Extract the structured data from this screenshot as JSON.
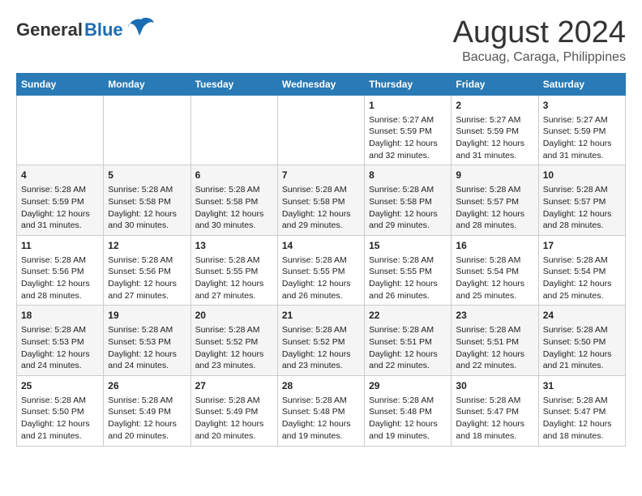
{
  "header": {
    "logo_general": "General",
    "logo_blue": "Blue",
    "month_title": "August 2024",
    "location": "Bacuag, Caraga, Philippines"
  },
  "days_of_week": [
    "Sunday",
    "Monday",
    "Tuesday",
    "Wednesday",
    "Thursday",
    "Friday",
    "Saturday"
  ],
  "weeks": [
    [
      {
        "day": "",
        "content": ""
      },
      {
        "day": "",
        "content": ""
      },
      {
        "day": "",
        "content": ""
      },
      {
        "day": "",
        "content": ""
      },
      {
        "day": "1",
        "content": "Sunrise: 5:27 AM\nSunset: 5:59 PM\nDaylight: 12 hours\nand 32 minutes."
      },
      {
        "day": "2",
        "content": "Sunrise: 5:27 AM\nSunset: 5:59 PM\nDaylight: 12 hours\nand 31 minutes."
      },
      {
        "day": "3",
        "content": "Sunrise: 5:27 AM\nSunset: 5:59 PM\nDaylight: 12 hours\nand 31 minutes."
      }
    ],
    [
      {
        "day": "4",
        "content": "Sunrise: 5:28 AM\nSunset: 5:59 PM\nDaylight: 12 hours\nand 31 minutes."
      },
      {
        "day": "5",
        "content": "Sunrise: 5:28 AM\nSunset: 5:58 PM\nDaylight: 12 hours\nand 30 minutes."
      },
      {
        "day": "6",
        "content": "Sunrise: 5:28 AM\nSunset: 5:58 PM\nDaylight: 12 hours\nand 30 minutes."
      },
      {
        "day": "7",
        "content": "Sunrise: 5:28 AM\nSunset: 5:58 PM\nDaylight: 12 hours\nand 29 minutes."
      },
      {
        "day": "8",
        "content": "Sunrise: 5:28 AM\nSunset: 5:58 PM\nDaylight: 12 hours\nand 29 minutes."
      },
      {
        "day": "9",
        "content": "Sunrise: 5:28 AM\nSunset: 5:57 PM\nDaylight: 12 hours\nand 28 minutes."
      },
      {
        "day": "10",
        "content": "Sunrise: 5:28 AM\nSunset: 5:57 PM\nDaylight: 12 hours\nand 28 minutes."
      }
    ],
    [
      {
        "day": "11",
        "content": "Sunrise: 5:28 AM\nSunset: 5:56 PM\nDaylight: 12 hours\nand 28 minutes."
      },
      {
        "day": "12",
        "content": "Sunrise: 5:28 AM\nSunset: 5:56 PM\nDaylight: 12 hours\nand 27 minutes."
      },
      {
        "day": "13",
        "content": "Sunrise: 5:28 AM\nSunset: 5:55 PM\nDaylight: 12 hours\nand 27 minutes."
      },
      {
        "day": "14",
        "content": "Sunrise: 5:28 AM\nSunset: 5:55 PM\nDaylight: 12 hours\nand 26 minutes."
      },
      {
        "day": "15",
        "content": "Sunrise: 5:28 AM\nSunset: 5:55 PM\nDaylight: 12 hours\nand 26 minutes."
      },
      {
        "day": "16",
        "content": "Sunrise: 5:28 AM\nSunset: 5:54 PM\nDaylight: 12 hours\nand 25 minutes."
      },
      {
        "day": "17",
        "content": "Sunrise: 5:28 AM\nSunset: 5:54 PM\nDaylight: 12 hours\nand 25 minutes."
      }
    ],
    [
      {
        "day": "18",
        "content": "Sunrise: 5:28 AM\nSunset: 5:53 PM\nDaylight: 12 hours\nand 24 minutes."
      },
      {
        "day": "19",
        "content": "Sunrise: 5:28 AM\nSunset: 5:53 PM\nDaylight: 12 hours\nand 24 minutes."
      },
      {
        "day": "20",
        "content": "Sunrise: 5:28 AM\nSunset: 5:52 PM\nDaylight: 12 hours\nand 23 minutes."
      },
      {
        "day": "21",
        "content": "Sunrise: 5:28 AM\nSunset: 5:52 PM\nDaylight: 12 hours\nand 23 minutes."
      },
      {
        "day": "22",
        "content": "Sunrise: 5:28 AM\nSunset: 5:51 PM\nDaylight: 12 hours\nand 22 minutes."
      },
      {
        "day": "23",
        "content": "Sunrise: 5:28 AM\nSunset: 5:51 PM\nDaylight: 12 hours\nand 22 minutes."
      },
      {
        "day": "24",
        "content": "Sunrise: 5:28 AM\nSunset: 5:50 PM\nDaylight: 12 hours\nand 21 minutes."
      }
    ],
    [
      {
        "day": "25",
        "content": "Sunrise: 5:28 AM\nSunset: 5:50 PM\nDaylight: 12 hours\nand 21 minutes."
      },
      {
        "day": "26",
        "content": "Sunrise: 5:28 AM\nSunset: 5:49 PM\nDaylight: 12 hours\nand 20 minutes."
      },
      {
        "day": "27",
        "content": "Sunrise: 5:28 AM\nSunset: 5:49 PM\nDaylight: 12 hours\nand 20 minutes."
      },
      {
        "day": "28",
        "content": "Sunrise: 5:28 AM\nSunset: 5:48 PM\nDaylight: 12 hours\nand 19 minutes."
      },
      {
        "day": "29",
        "content": "Sunrise: 5:28 AM\nSunset: 5:48 PM\nDaylight: 12 hours\nand 19 minutes."
      },
      {
        "day": "30",
        "content": "Sunrise: 5:28 AM\nSunset: 5:47 PM\nDaylight: 12 hours\nand 18 minutes."
      },
      {
        "day": "31",
        "content": "Sunrise: 5:28 AM\nSunset: 5:47 PM\nDaylight: 12 hours\nand 18 minutes."
      }
    ]
  ]
}
